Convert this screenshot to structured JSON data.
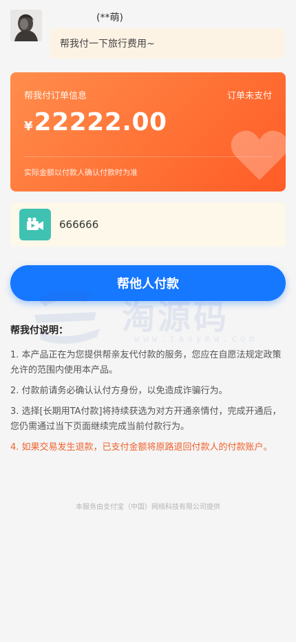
{
  "header": {
    "nickname": "(**萌)",
    "message": "帮我付一下旅行费用~"
  },
  "order": {
    "title": "帮我付订单信息",
    "status": "订单未支付",
    "currency": "¥",
    "amount": "22222.00",
    "note": "实际金额以付款人确认付款时为准"
  },
  "payer": {
    "name": "666666",
    "icon": "video-camera-icon"
  },
  "actions": {
    "pay_label": "帮他人付款"
  },
  "watermark": {
    "text": "淘源码",
    "url": "www.taoymw.com"
  },
  "instructions": {
    "title": "帮我付说明：",
    "items": [
      "1. 本产品正在为您提供帮亲友代付款的服务，您应在自愿法规定政策允许的范围内使用本产品。",
      "2. 付款前请务必确认认付方身份，以免造成诈骗行为。",
      "3. 选择[长期用TA付款]将持续获选为对方开通亲情付，完成开通后，您仍需通过当下页面继续完成当前付款行为。",
      "4. 如果交易发生退款，已支付金额将原路退回付款人的付款账户。"
    ]
  },
  "footer": {
    "text": "本服务由支付宝（中国）网络科技有限公司提供"
  },
  "colors": {
    "order_card": "#ff7236",
    "pay_button": "#1677ff",
    "warning_text": "#f0612d",
    "video_icon_bg": "#3fc2b2"
  }
}
